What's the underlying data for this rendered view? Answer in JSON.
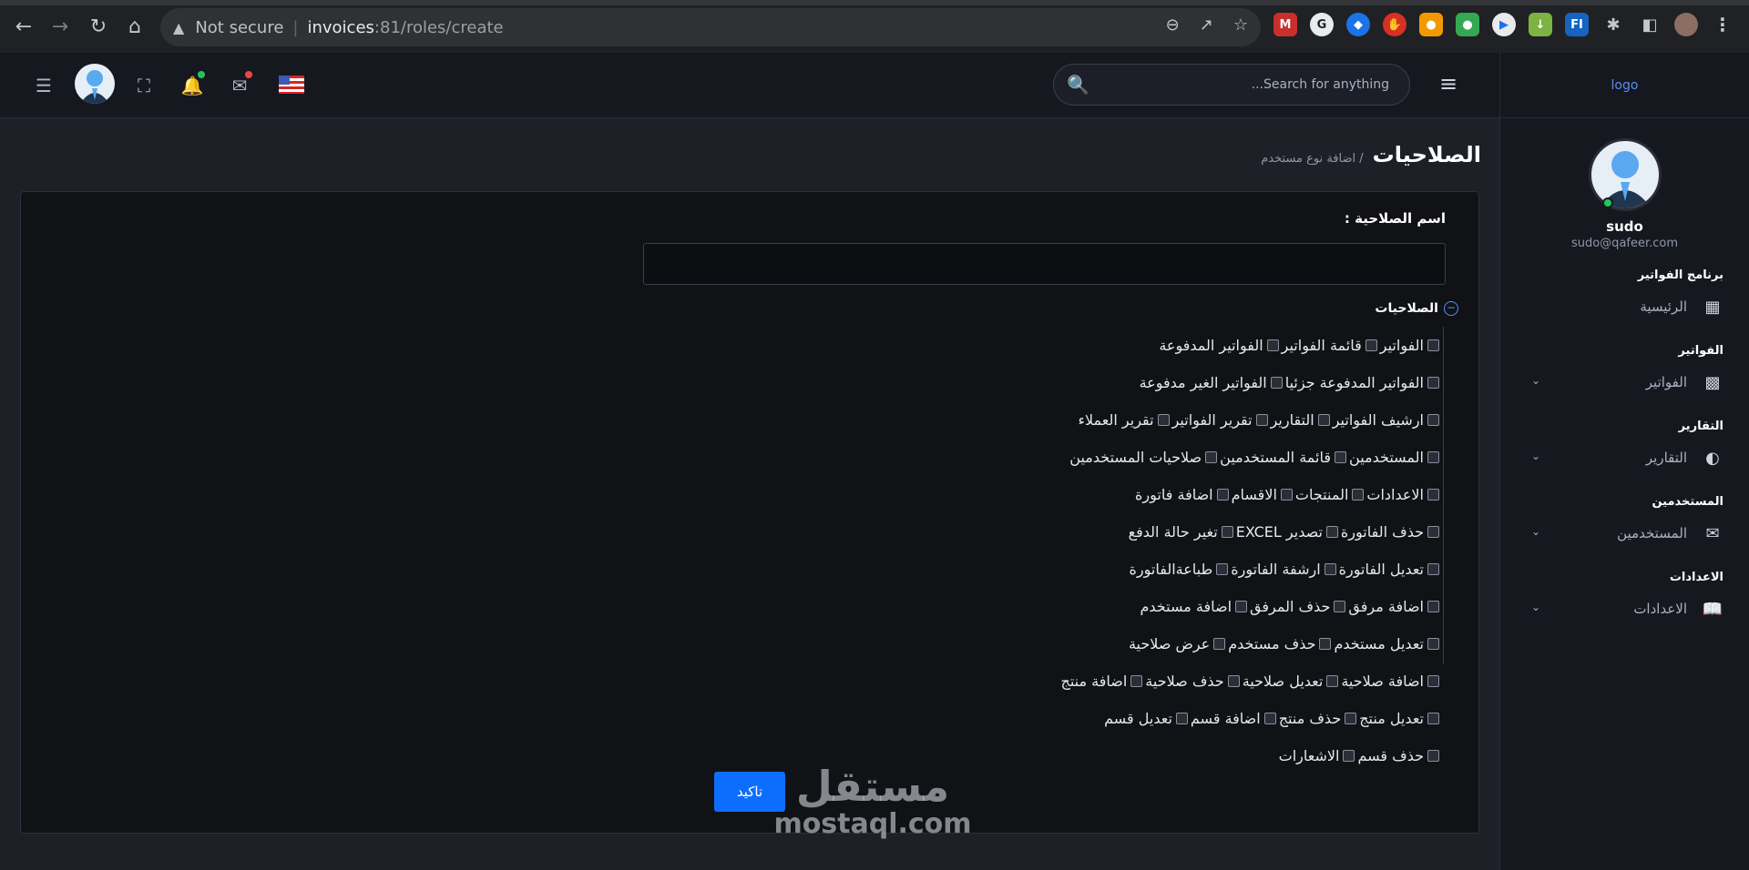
{
  "browser": {
    "security_label": "Not secure",
    "url_host": "invoices",
    "url_path": ":81/roles/create"
  },
  "header": {
    "search_placeholder": "...Search for anything"
  },
  "sidebar": {
    "logo": "logo",
    "user_name": "sudo",
    "user_email": "sudo@qafeer.com",
    "sections": [
      {
        "title": "برنامج الفواتير",
        "item": "الرئيسية",
        "icon": "dashboard-icon",
        "has_chevron": false
      },
      {
        "title": "الفواتير",
        "item": "الفواتير",
        "icon": "bar-chart-icon",
        "has_chevron": true
      },
      {
        "title": "التقارير",
        "item": "التقارير",
        "icon": "half-circle-icon",
        "has_chevron": true
      },
      {
        "title": "المستخدمين",
        "item": "المستخدمين",
        "icon": "chat-icon",
        "has_chevron": true
      },
      {
        "title": "الاعدادات",
        "item": "الاعدادات",
        "icon": "book-icon",
        "has_chevron": true
      }
    ]
  },
  "page": {
    "title": "الصلاحيات",
    "breadcrumb": "/ اضافة نوع مستخدم"
  },
  "form": {
    "name_label": "اسم الصلاحية :",
    "name_value": "",
    "permissions_label": "الصلاحيات",
    "confirm_label": "تاكيد"
  },
  "permissions": [
    [
      "الفواتير",
      "قائمة الفواتير",
      "الفواتير المدفوعة"
    ],
    [
      "الفواتير المدفوعة جزئيا",
      "الفواتير الغير مدفوعة"
    ],
    [
      "ارشيف الفواتير",
      "التقارير",
      "تقرير الفواتير",
      "تقرير العملاء"
    ],
    [
      "المستخدمين",
      "قائمة المستخدمين",
      "صلاحيات المستخدمين"
    ],
    [
      "الاعدادات",
      "المنتجات",
      "الاقسام",
      "اضافة فاتورة"
    ],
    [
      "حذف الفاتورة",
      "تصدير EXCEL",
      "تغير حالة الدفع"
    ],
    [
      "تعديل الفاتورة",
      "ارشفة الفاتورة",
      "طباعةالفاتورة"
    ],
    [
      "اضافة مرفق",
      "حذف المرفق",
      "اضافة مستخدم"
    ],
    [
      "تعديل مستخدم",
      "حذف مستخدم",
      "عرض صلاحية"
    ],
    [
      "اضافة صلاحية",
      "تعديل صلاحية",
      "حذف صلاحية",
      "اضافة منتج"
    ],
    [
      "تعديل منتج",
      "حذف منتج",
      "اضافة قسم",
      "تعديل قسم"
    ],
    [
      "حذف قسم",
      "الاشعارات"
    ]
  ],
  "watermark": {
    "arabic": "مستقل",
    "latin": "mostaql.com"
  }
}
